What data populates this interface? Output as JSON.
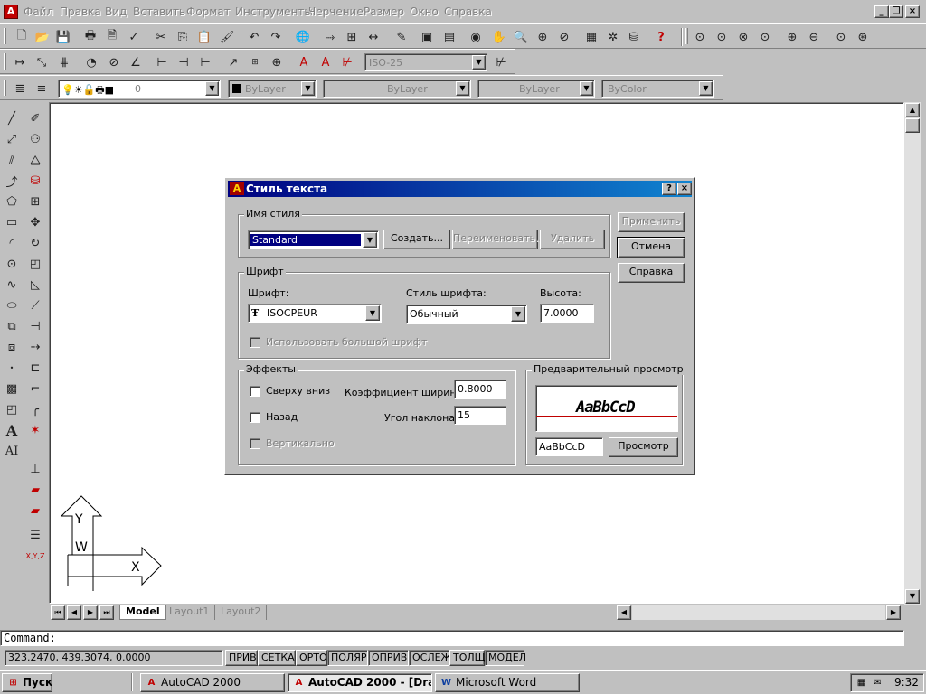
{
  "menubar": {
    "items": [
      "Файл",
      "Правка",
      "Вид",
      "Вставить",
      "Формат",
      "Инструменты",
      "Черчение",
      "Размер",
      "Окно",
      "Справка"
    ]
  },
  "toolbars": {
    "dimstyle": "ISO-25",
    "layer": "0",
    "color": "ByLayer",
    "linetype": "ByLayer",
    "lineweight": "ByLayer",
    "plotstyle": "ByColor"
  },
  "layout_tabs": [
    "Model",
    "Layout1",
    "Layout2"
  ],
  "command": {
    "prompt": "Command:"
  },
  "status": {
    "coords": "323.2470, 439.3074, 0.0000",
    "buttons": [
      "ПРИВ",
      "СЕТКА",
      "ОРТО",
      "ПОЛЯР",
      "ОПРИВ",
      "ОСЛЕЖ",
      "ТОЛЩ",
      "МОДЕЛ"
    ]
  },
  "taskbar": {
    "start": "Пуск",
    "tasks": [
      "AutoCAD 2000",
      "AutoCAD 2000 - [Dra...",
      "Microsoft Word"
    ],
    "clock": "9:32"
  },
  "dialog": {
    "title": "Стиль текста",
    "style_group": "Имя стиля",
    "style_value": "Standard",
    "btn_create": "Создать...",
    "btn_rename": "Переименовать...",
    "btn_delete": "Удалить",
    "btn_apply": "Применить",
    "btn_cancel": "Отмена",
    "btn_help": "Справка",
    "font_group": "Шрифт",
    "font_label": "Шрифт:",
    "font_value": "ISOCPEUR",
    "fontstyle_label": "Стиль шрифта:",
    "fontstyle_value": "Обычный",
    "height_label": "Высота:",
    "height_value": "7.0000",
    "bigfont_label": "Использовать большой шрифт",
    "effects_group": "Эффекты",
    "upside_down": "Сверху вниз",
    "backwards": "Назад",
    "vertical": "Вертикально",
    "width_label": "Коэффициент ширины:",
    "width_value": "0.8000",
    "oblique_label": "Угол наклона:",
    "oblique_value": "15",
    "preview_group": "Предварительный просмотр",
    "preview_sample": "AaBbCcD",
    "preview_input": "AaBbCcD",
    "btn_preview": "Просмотр"
  },
  "ucs": {
    "y_label": "Y",
    "w_label": "W",
    "x_label": "X"
  }
}
